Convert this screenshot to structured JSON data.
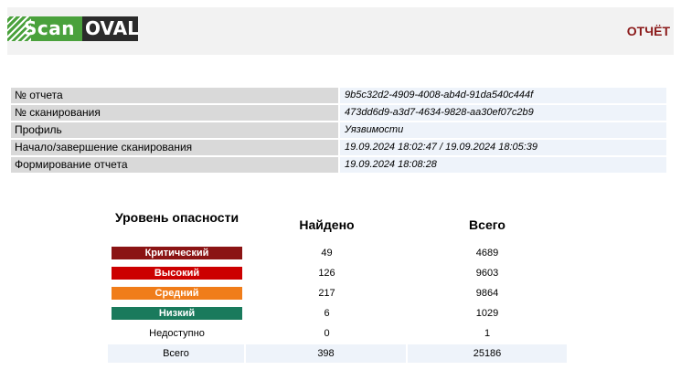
{
  "header": {
    "logo_scan": "Scan",
    "logo_oval": "OVAL",
    "report_word": "ОТЧЁТ"
  },
  "meta": {
    "rows": [
      {
        "label": "№ отчета",
        "value": "9b5c32d2-4909-4008-ab4d-91da540c444f"
      },
      {
        "label": "№ сканирования",
        "value": "473dd6d9-a3d7-4634-9828-aa30ef07c2b9"
      },
      {
        "label": "Профиль",
        "value": "Уязвимости"
      },
      {
        "label": "Начало/завершение сканирования",
        "value": "19.09.2024 18:02:47 / 19.09.2024 18:05:39"
      },
      {
        "label": "Формирование отчета",
        "value": "19.09.2024 18:08:28"
      }
    ]
  },
  "summary": {
    "headers": {
      "level": "Уровень опасности",
      "found": "Найдено",
      "total": "Всего"
    },
    "rows": [
      {
        "level": "Критический",
        "found": "49",
        "total": "4689",
        "color": "#8b1414"
      },
      {
        "level": "Высокий",
        "found": "126",
        "total": "9603",
        "color": "#cc0000"
      },
      {
        "level": "Средний",
        "found": "217",
        "total": "9864",
        "color": "#f07d1a"
      },
      {
        "level": "Низкий",
        "found": "6",
        "total": "1029",
        "color": "#1a7a5c"
      },
      {
        "level": "Недоступно",
        "found": "0",
        "total": "1",
        "color": ""
      }
    ],
    "totals": {
      "label": "Всего",
      "found": "398",
      "total": "25186"
    }
  }
}
